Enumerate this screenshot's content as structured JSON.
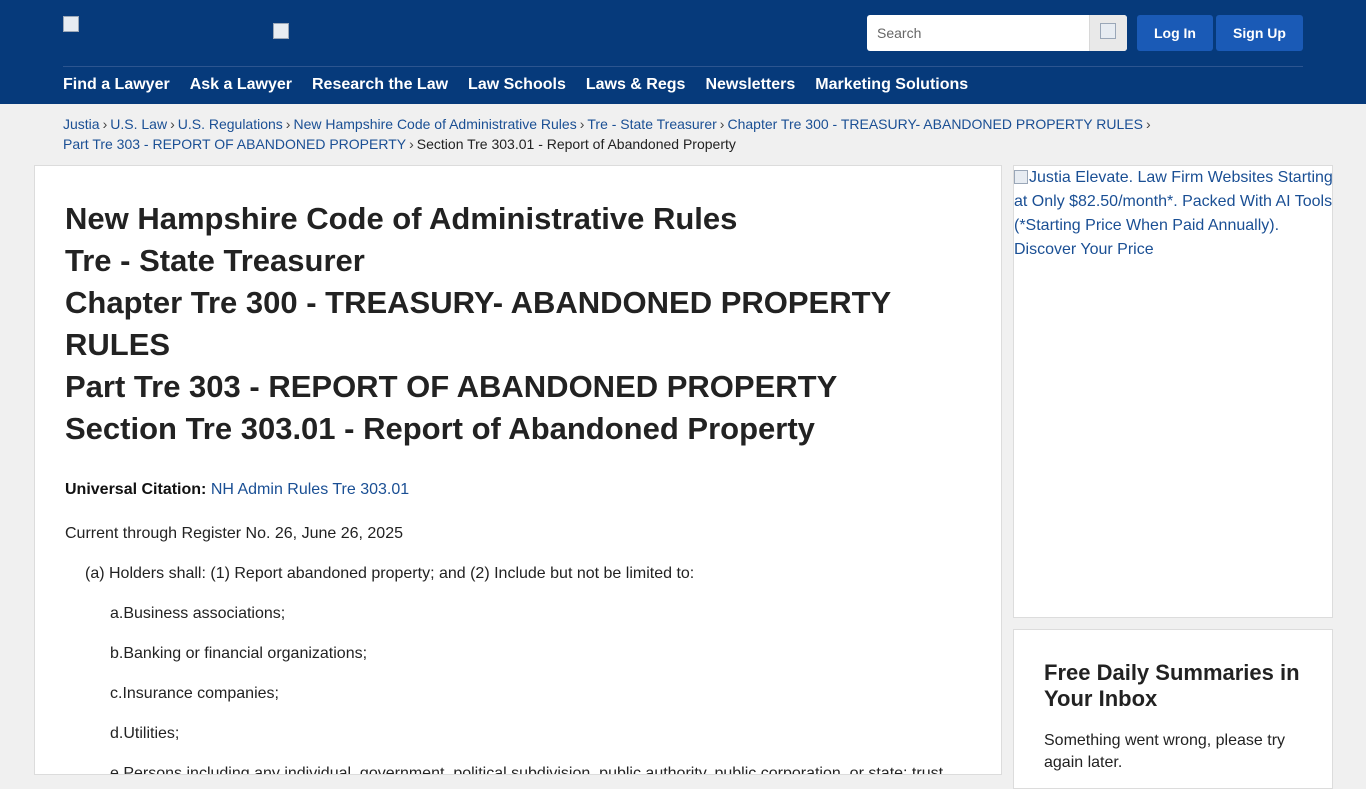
{
  "header": {
    "search_placeholder": "Search",
    "login_label": "Log In",
    "signup_label": "Sign Up",
    "nav": [
      "Find a Lawyer",
      "Ask a Lawyer",
      "Research the Law",
      "Law Schools",
      "Laws & Regs",
      "Newsletters",
      "Marketing Solutions"
    ],
    "colors": {
      "header_bg": "#063a7b",
      "button_bg": "#1a5ab6",
      "link": "#1a4f94"
    }
  },
  "breadcrumb": {
    "links": [
      "Justia",
      "U.S. Law",
      "U.S. Regulations",
      "New Hampshire Code of Administrative Rules",
      "Tre - State Treasurer",
      "Chapter Tre 300 - TREASURY- ABANDONED PROPERTY RULES",
      "Part Tre 303 - REPORT OF ABANDONED PROPERTY"
    ],
    "current": "Section Tre 303.01 - Report of Abandoned Property",
    "separator": "›"
  },
  "main": {
    "headings": [
      "New Hampshire Code of Administrative Rules",
      "Tre - State Treasurer",
      "Chapter Tre 300 - TREASURY- ABANDONED PROPERTY RULES",
      "Part Tre 303 - REPORT OF ABANDONED PROPERTY",
      "Section Tre 303.01 - Report of Abandoned Property"
    ],
    "citation_label": "Universal Citation:",
    "citation_link": "NH Admin Rules Tre 303.01",
    "current_through": "Current through Register No. 26, June 26, 2025",
    "paragraphs": [
      "(a) Holders shall: (1) Report abandoned property; and (2) Include but not be limited to:",
      "a.Business associations;",
      "b.Banking or financial organizations;",
      "c.Insurance companies;",
      "d.Utilities;",
      "e.Persons including any individual, government, political subdivision, public authority, public corporation, or state; trust"
    ]
  },
  "sidebar": {
    "ad_alt": "Justia Elevate. Law Firm Websites Starting at Only $82.50/month*. Packed With AI Tools (*Starting Price When Paid Annually). Discover Your Price",
    "newsletter_title": "Free Daily Summaries in Your Inbox",
    "newsletter_error": "Something went wrong, please try again later."
  }
}
